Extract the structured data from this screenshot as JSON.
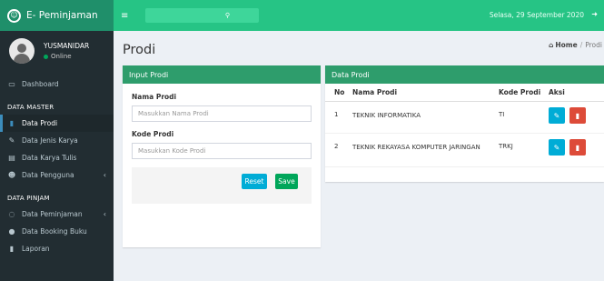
{
  "app": {
    "title": "E- Peminjaman"
  },
  "user": {
    "name": "YUSMANIDAR",
    "status": "Online"
  },
  "sidebar": {
    "dashboard": "Dashboard",
    "master_header": "DATA MASTER",
    "master_items": [
      "Data Prodi",
      "Data Jenis Karya",
      "Data Karya Tulis",
      "Data Pengguna"
    ],
    "pinjam_header": "DATA PINJAM",
    "pinjam_items": [
      "Data Peminjaman",
      "Data Booking Buku",
      "Laporan"
    ]
  },
  "topbar": {
    "date": "Selasa, 29 September 2020"
  },
  "page": {
    "title": "Prodi",
    "breadcrumb_home": "Home",
    "breadcrumb_current": "Prodi"
  },
  "form": {
    "header": "Input Prodi",
    "nama_label": "Nama Prodi",
    "nama_placeholder": "Masukkan Nama Prodi",
    "kode_label": "Kode Prodi",
    "kode_placeholder": "Masukkan Kode Prodi",
    "reset_label": "Reset",
    "save_label": "Save"
  },
  "table": {
    "header": "Data Prodi",
    "columns": [
      "No",
      "Nama Prodi",
      "Kode Prodi",
      "Aksi"
    ],
    "rows": [
      {
        "no": "1",
        "nama": "TEKNIK INFORMATIKA",
        "kode": "TI"
      },
      {
        "no": "2",
        "nama": "TEKNIK REKAYASA KOMPUTER JARINGAN",
        "kode": "TRKJ"
      }
    ]
  },
  "colors": {
    "brand": "#1f8f6a",
    "topbar": "#26c485",
    "sidebar": "#222d32",
    "box_header": "#2e9d6c",
    "btn_info": "#00acd6",
    "btn_success": "#00a65a",
    "btn_danger": "#dd4b39"
  },
  "icons": [
    "app-logo-icon",
    "hamburger-icon",
    "search-icon",
    "logout-icon",
    "home-icon",
    "dashboard-icon",
    "prodi-icon",
    "jenis-karya-icon",
    "karya-tulis-icon",
    "pengguna-icon",
    "peminjaman-icon",
    "booking-icon",
    "laporan-icon",
    "edit-icon",
    "delete-icon"
  ]
}
